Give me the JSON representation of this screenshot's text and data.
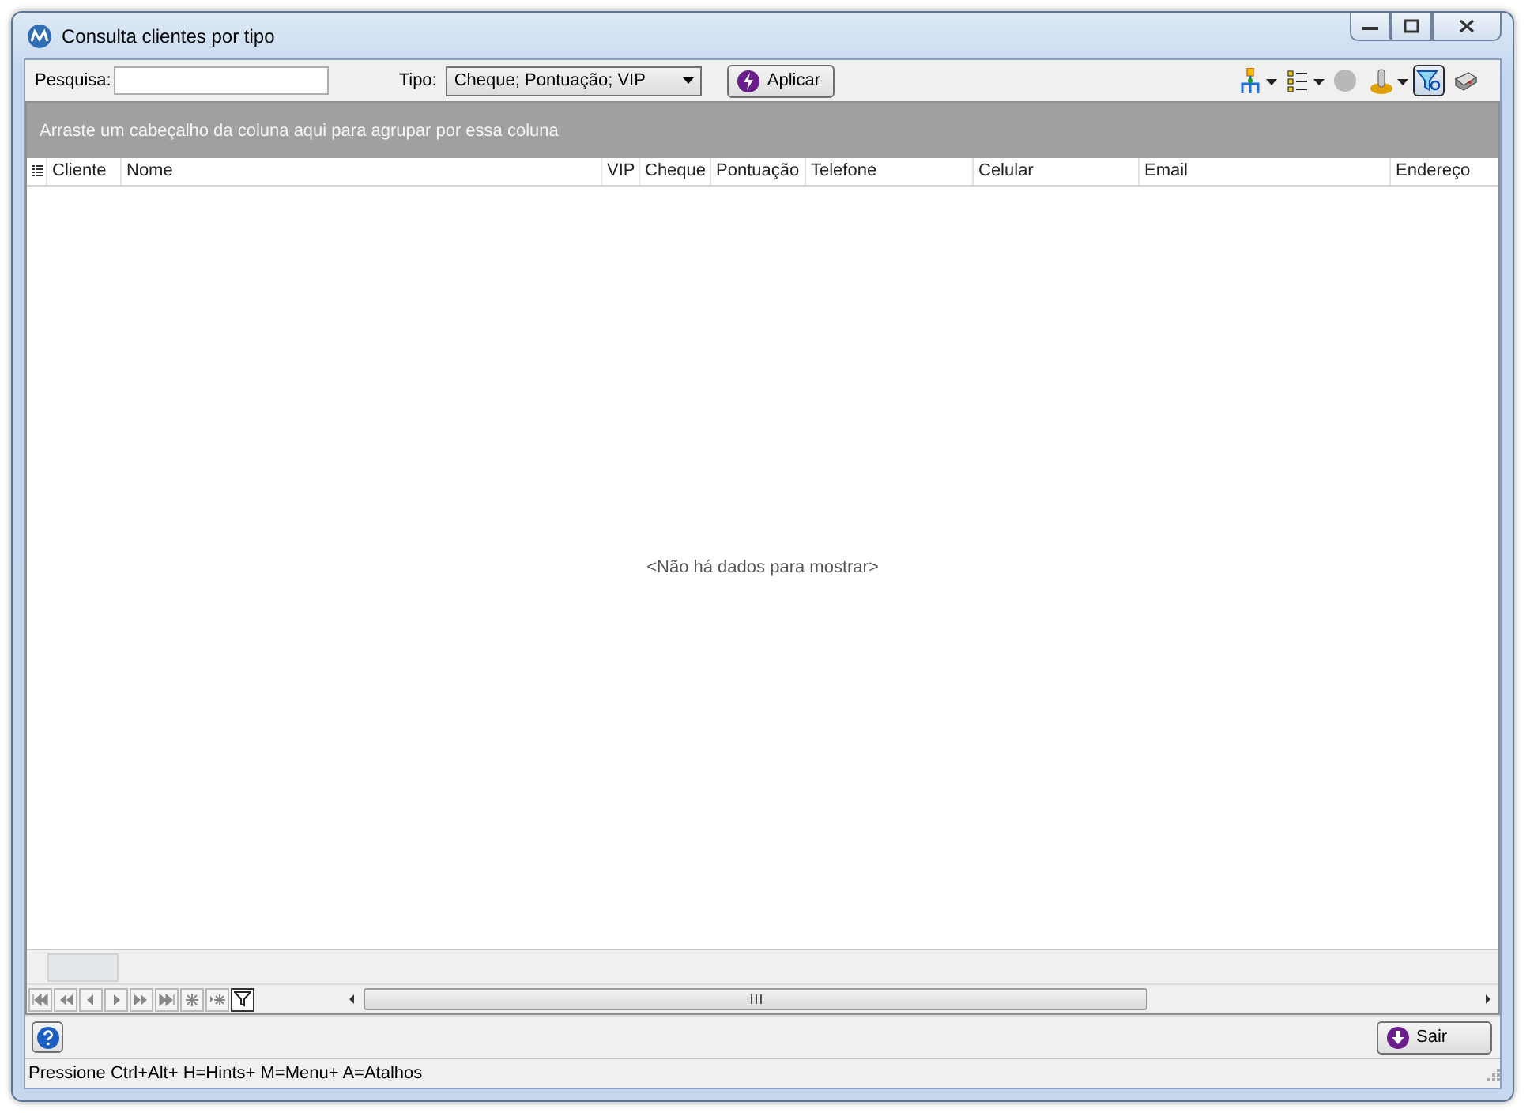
{
  "window": {
    "title": "Consulta clientes por tipo"
  },
  "search": {
    "label": "Pesquisa:"
  },
  "type_filter": {
    "label": "Tipo:",
    "value": "Cheque; Pontuação; VIP"
  },
  "apply_button": "Aplicar",
  "filter_toggle": {
    "pressed": true
  },
  "group_panel": "Arraste um cabeçalho da coluna aqui para agrupar por essa coluna",
  "table": {
    "columns": [
      "Cliente",
      "Nome",
      "VIP",
      "Cheque",
      "Pontuação",
      "Telefone",
      "Celular",
      "Email",
      "Endereço"
    ],
    "empty_message": "<Não há dados para mostrar>"
  },
  "exit_button": "Sair",
  "status_bar": "Pressione Ctrl+Alt+ H=Hints+ M=Menu+ A=Atalhos"
}
